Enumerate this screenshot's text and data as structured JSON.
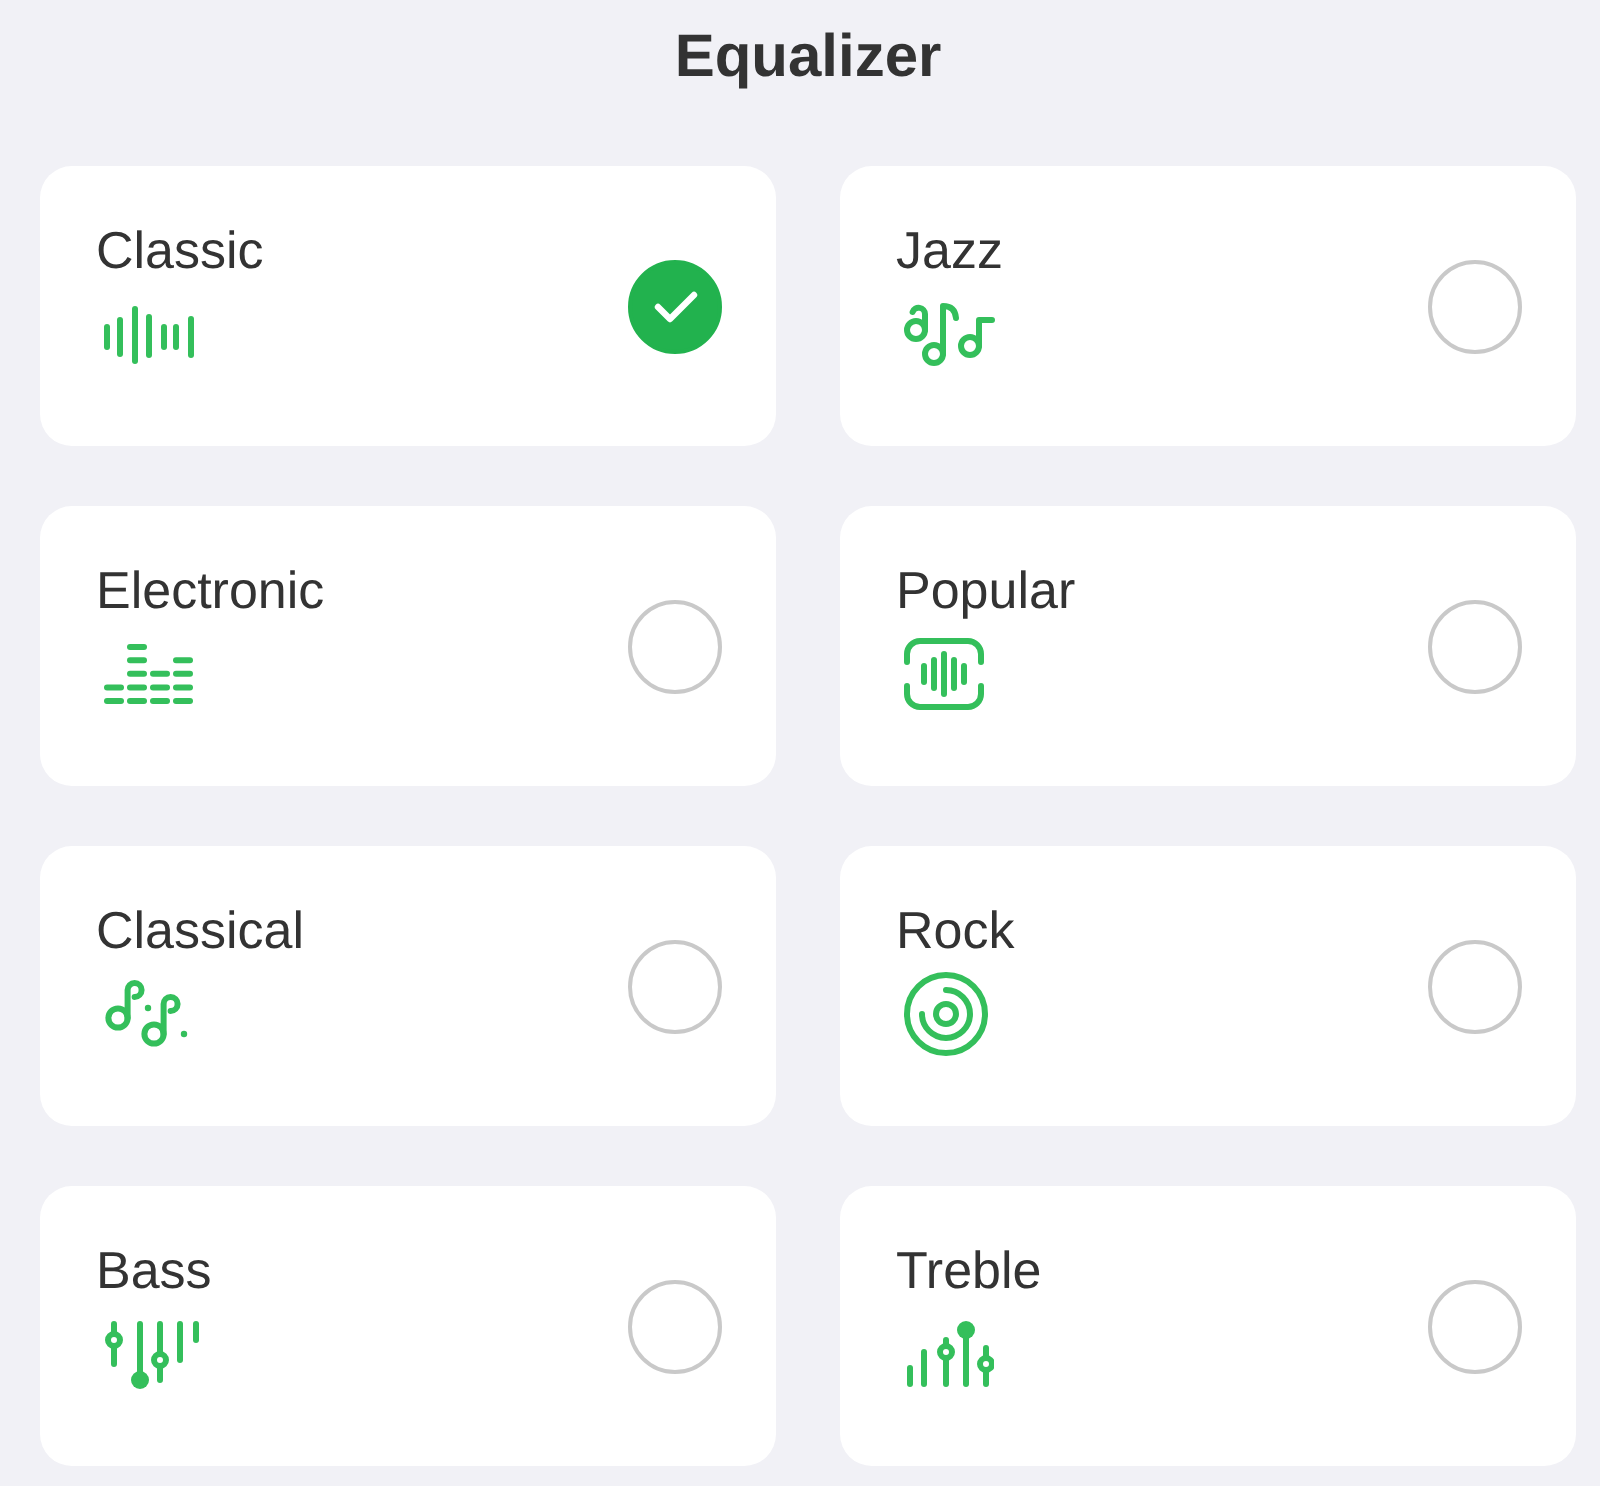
{
  "title": "Equalizer",
  "presets": [
    {
      "label": "Classic",
      "kind": "waveform",
      "selected": true
    },
    {
      "label": "Jazz",
      "kind": "notes",
      "selected": false
    },
    {
      "label": "Electronic",
      "kind": "levels",
      "selected": false
    },
    {
      "label": "Popular",
      "kind": "framed",
      "selected": false
    },
    {
      "label": "Classical",
      "kind": "dotted",
      "selected": false
    },
    {
      "label": "Rock",
      "kind": "disc",
      "selected": false
    },
    {
      "label": "Bass",
      "kind": "bass",
      "selected": false
    },
    {
      "label": "Treble",
      "kind": "treble",
      "selected": false
    }
  ]
}
